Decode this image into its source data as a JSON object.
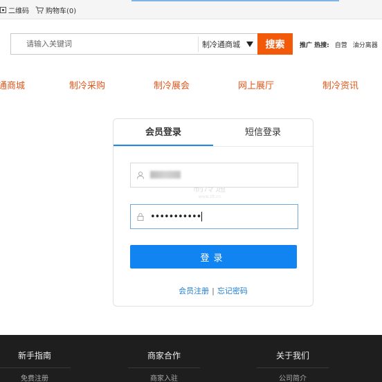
{
  "topbar": {
    "qrcode_label": "二维码",
    "cart_label": "购物车(0)"
  },
  "search": {
    "placeholder": "请输入关键词",
    "scope": "制冷通商城",
    "button": "搜索"
  },
  "hot": {
    "label": "推广 热搜:",
    "keywords": [
      "自营",
      "油分离器"
    ]
  },
  "nav": [
    "通商城",
    "制冷采购",
    "制冷展会",
    "网上展厅",
    "制冷资讯"
  ],
  "login": {
    "tabs": [
      "会员登录",
      "短信登录"
    ],
    "password_value": "•••••••••••",
    "button": "登录",
    "register_link": "会员注册",
    "separator": "|",
    "forgot_link": "忘记密码",
    "watermark": "制冷通",
    "watermark_url": "www.zlt.cn"
  },
  "footer": {
    "columns": [
      {
        "title": "新手指南",
        "sub": "免费注册"
      },
      {
        "title": "商家合作",
        "sub": "商家入驻"
      },
      {
        "title": "关于我们",
        "sub": "公司简介"
      }
    ]
  },
  "colors": {
    "brand_orange": "#f25a0a",
    "nav_orange": "#e2561b",
    "primary_blue": "#1184f2",
    "footer_bg": "#1e1e1e"
  }
}
